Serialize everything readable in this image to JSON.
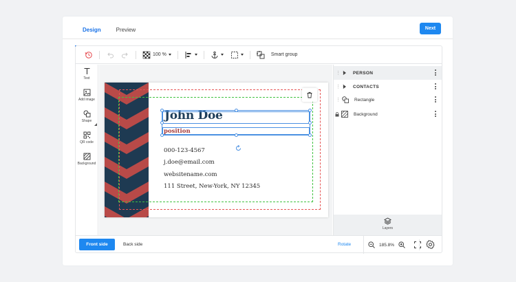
{
  "tabs": [
    {
      "label": "Design",
      "active": true
    },
    {
      "label": "Preview",
      "active": false
    }
  ],
  "next_label": "Next",
  "toolbar": {
    "zoom": "100 %",
    "smart_group": "Smart group"
  },
  "tools": [
    {
      "label": "Text",
      "icon": "text-icon"
    },
    {
      "label": "Add image",
      "icon": "image-icon"
    },
    {
      "label": "Shape",
      "icon": "shape-icon"
    },
    {
      "label": "QR code",
      "icon": "qr-code-icon"
    },
    {
      "label": "Background",
      "icon": "background-icon"
    },
    {
      "label": "Layers",
      "icon": "layers-icon"
    }
  ],
  "card": {
    "name": "John Doe",
    "position": "position",
    "phone": "000-123-4567",
    "email": "j.doe@email.com",
    "website": "websitename.com",
    "address": "111 Street, New-York, NY 12345",
    "colors": {
      "stripe_dark": "#1e3a52",
      "stripe_red": "#b84a48",
      "name": "#1f3f5b",
      "position": "#a33838"
    }
  },
  "layers": [
    {
      "label": "PERSON",
      "type": "group"
    },
    {
      "label": "CONTACTS",
      "type": "group"
    },
    {
      "label": "Rectangle",
      "type": "shape"
    },
    {
      "label": "Background",
      "type": "background"
    }
  ],
  "bottom": {
    "front_side": "Front side",
    "back_side": "Back side",
    "rotate": "Rotate",
    "zoom": "185.8%"
  },
  "accent_color": "#1e88f0"
}
